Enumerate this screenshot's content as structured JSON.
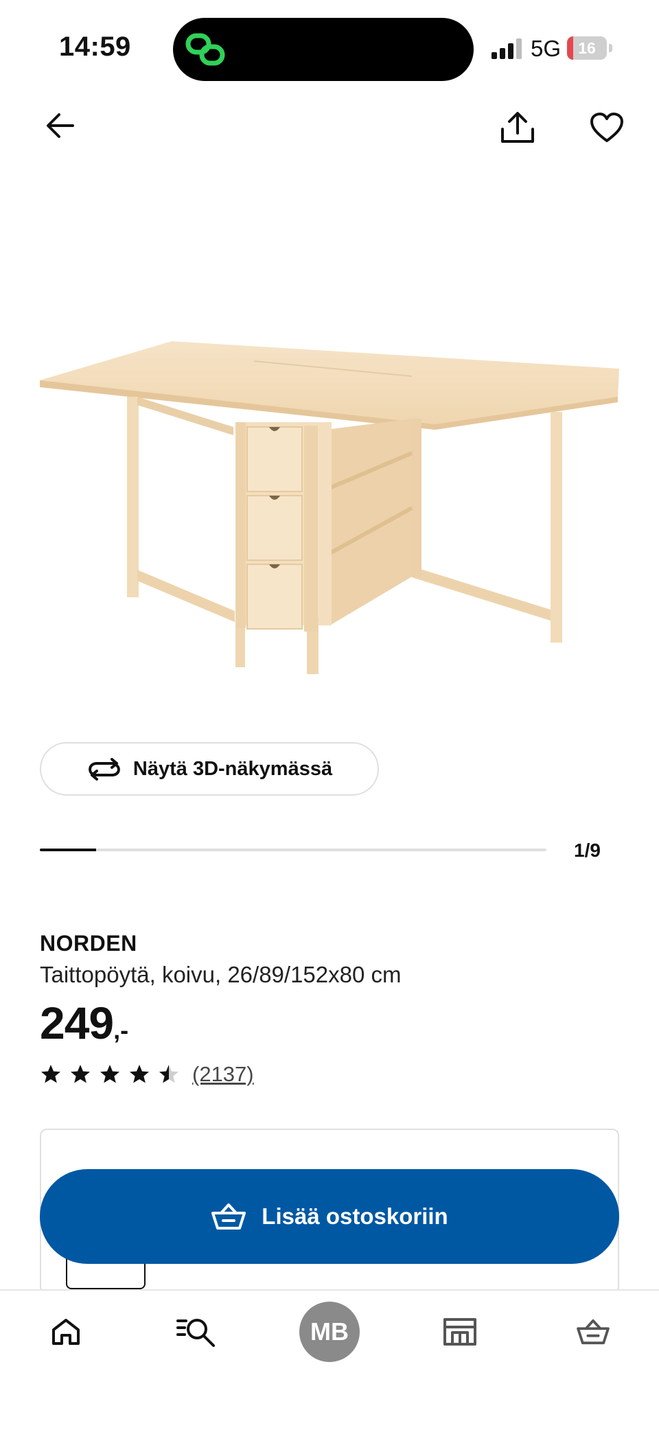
{
  "status_bar": {
    "time": "14:59",
    "network": "5G",
    "battery_level": "16",
    "battery_fraction": 0.16
  },
  "colors": {
    "accent_blue": "#0058a3",
    "text": "#111111",
    "battery_low": "#e5484d",
    "island_icon": "#30d158"
  },
  "icons": {
    "back": "arrow-left-icon",
    "share": "share-icon",
    "favorite": "heart-icon",
    "view_3d": "rotate-icon",
    "cart": "shopping-basket-icon",
    "nav_home": "home-icon",
    "nav_search": "search-icon",
    "nav_stores": "store-icon",
    "nav_cart": "shopping-basket-icon"
  },
  "gallery": {
    "view_3d_label": "Näytä 3D-näkymässä",
    "current": 1,
    "total": 9,
    "counter": "1/9",
    "progress_fraction": 0.111
  },
  "product": {
    "name": "NORDEN",
    "description": "Taittopöytä, koivu, 26/89/152x80 cm",
    "price_integer": "249",
    "price_decimal": ",-",
    "rating": 4.5,
    "rating_max": 5,
    "review_count": "(2137)"
  },
  "cta": {
    "label": "Lisää ostoskoriin"
  },
  "bottom_nav": {
    "avatar_initials": "MB"
  }
}
